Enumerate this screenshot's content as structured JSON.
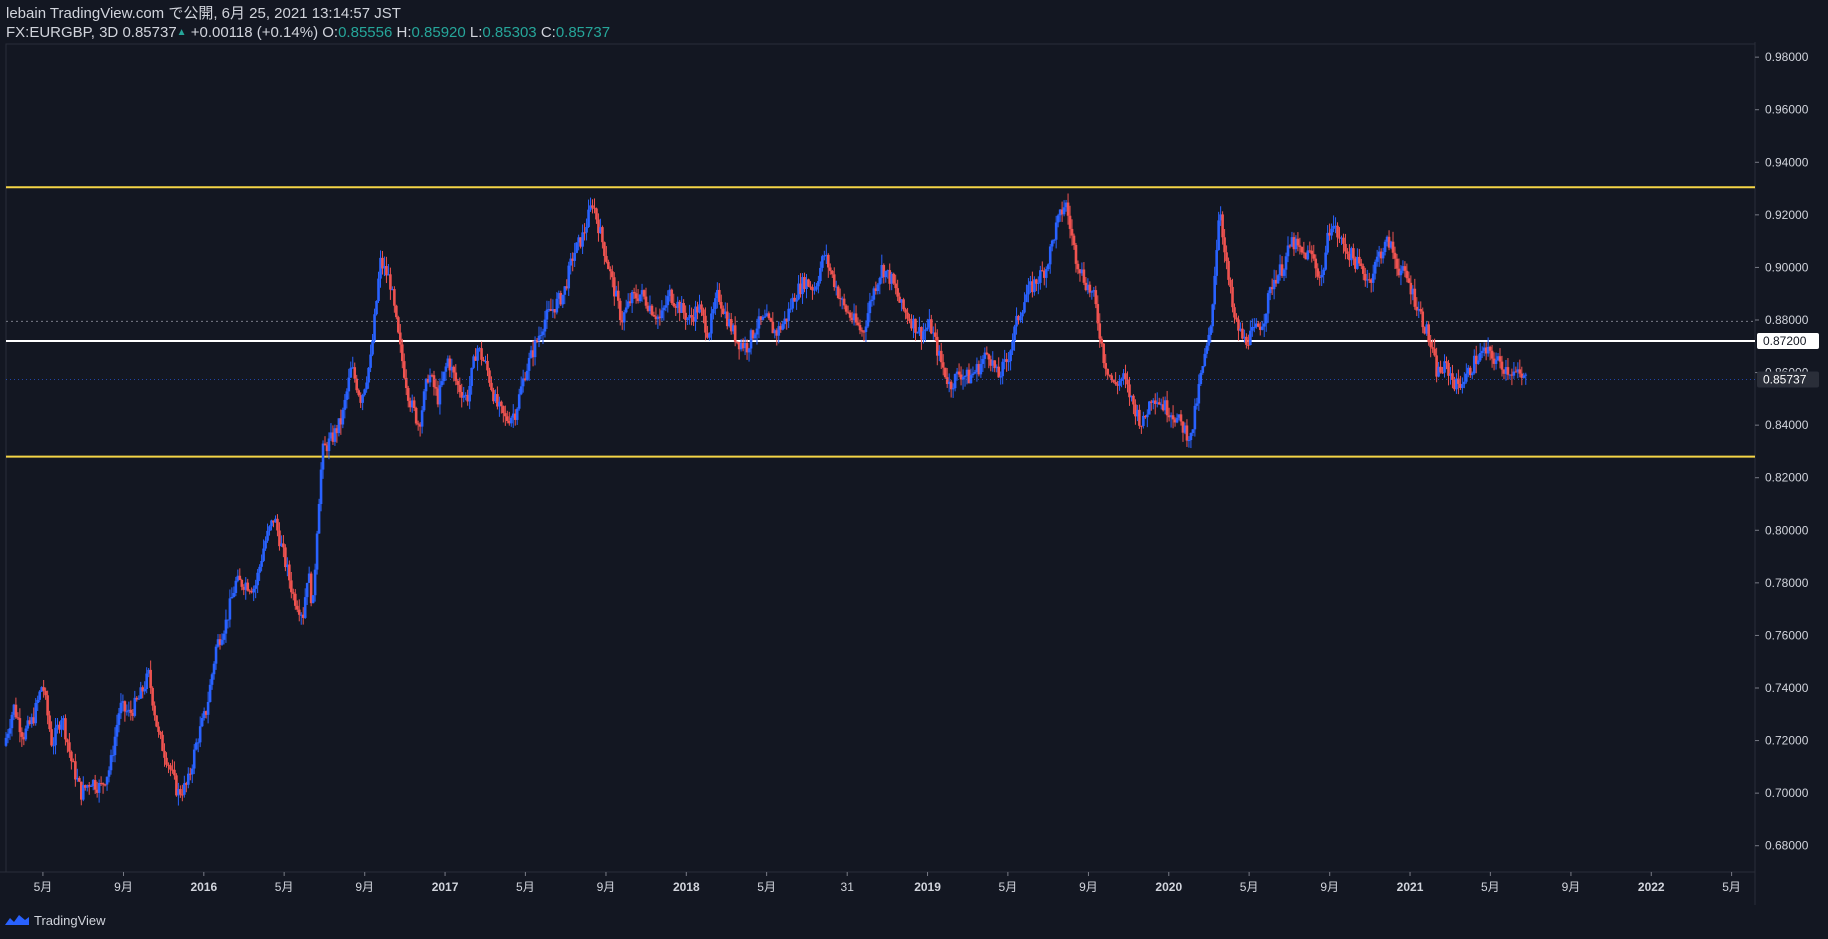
{
  "header": {
    "publisher_line": "lebain TradingView.com で公開, 6月 25, 2021 13:14:57 JST",
    "symbol": "FX:EURGBP, 3D",
    "last": "0.85737",
    "change": "+0.00118 (+0.14%)",
    "o_label": "O:",
    "o_value": "0.85556",
    "h_label": "H:",
    "h_value": "0.85920",
    "l_label": "L:",
    "l_value": "0.85303",
    "c_label": "C:",
    "c_value": "0.85737"
  },
  "footer": {
    "brand": "TradingView"
  },
  "colors": {
    "background": "#131722",
    "up": "#2962ff",
    "down": "#ef5350",
    "resistance": "#f5d547",
    "level": "#ffffff",
    "axis_text": "#d1d4dc"
  },
  "chart_data": {
    "type": "candlestick",
    "symbol": "FX:EURGBP",
    "interval": "3D",
    "ylim": [
      0.67,
      0.985
    ],
    "y_ticks": [
      "0.98000",
      "0.96000",
      "0.94000",
      "0.92000",
      "0.90000",
      "0.88000",
      "0.86000",
      "0.84000",
      "0.82000",
      "0.80000",
      "0.78000",
      "0.76000",
      "0.74000",
      "0.72000",
      "0.70000",
      "0.68000"
    ],
    "x_ticks": [
      {
        "label": "5月",
        "t": 2015.333
      },
      {
        "label": "9月",
        "t": 2015.667
      },
      {
        "label": "2016",
        "t": 2016.0
      },
      {
        "label": "5月",
        "t": 2016.333
      },
      {
        "label": "9月",
        "t": 2016.667
      },
      {
        "label": "2017",
        "t": 2017.0
      },
      {
        "label": "5月",
        "t": 2017.333
      },
      {
        "label": "9月",
        "t": 2017.667
      },
      {
        "label": "2018",
        "t": 2018.0
      },
      {
        "label": "5月",
        "t": 2018.333
      },
      {
        "label": "31",
        "t": 2018.667
      },
      {
        "label": "2019",
        "t": 2019.0
      },
      {
        "label": "5月",
        "t": 2019.333
      },
      {
        "label": "9月",
        "t": 2019.667
      },
      {
        "label": "2020",
        "t": 2020.0
      },
      {
        "label": "5月",
        "t": 2020.333
      },
      {
        "label": "9月",
        "t": 2020.667
      },
      {
        "label": "2021",
        "t": 2021.0
      },
      {
        "label": "5月",
        "t": 2021.333
      },
      {
        "label": "9月",
        "t": 2021.667
      },
      {
        "label": "2022",
        "t": 2022.0
      },
      {
        "label": "5月",
        "t": 2022.333
      }
    ],
    "x_range": [
      2015.18,
      2022.43
    ],
    "horizontal_lines": [
      {
        "name": "resistance",
        "price": 0.9305,
        "color": "#f5d547"
      },
      {
        "name": "support",
        "price": 0.828,
        "color": "#f5d547"
      },
      {
        "name": "level",
        "price": 0.872,
        "color": "#ffffff",
        "label": "0.87200"
      },
      {
        "name": "dotted",
        "price": 0.8795,
        "color": "#787b86"
      }
    ],
    "last_price_label": "0.85737",
    "last_price": 0.85737,
    "price_path": [
      [
        2015.18,
        0.718
      ],
      [
        2015.22,
        0.733
      ],
      [
        2015.26,
        0.722
      ],
      [
        2015.3,
        0.728
      ],
      [
        2015.34,
        0.742
      ],
      [
        2015.38,
        0.718
      ],
      [
        2015.42,
        0.73
      ],
      [
        2015.46,
        0.712
      ],
      [
        2015.5,
        0.7
      ],
      [
        2015.54,
        0.705
      ],
      [
        2015.58,
        0.702
      ],
      [
        2015.62,
        0.71
      ],
      [
        2015.66,
        0.733
      ],
      [
        2015.7,
        0.73
      ],
      [
        2015.74,
        0.736
      ],
      [
        2015.78,
        0.745
      ],
      [
        2015.82,
        0.722
      ],
      [
        2015.86,
        0.712
      ],
      [
        2015.9,
        0.7
      ],
      [
        2015.94,
        0.703
      ],
      [
        2015.98,
        0.72
      ],
      [
        2016.02,
        0.732
      ],
      [
        2016.06,
        0.756
      ],
      [
        2016.1,
        0.765
      ],
      [
        2016.14,
        0.78
      ],
      [
        2016.18,
        0.78
      ],
      [
        2016.22,
        0.778
      ],
      [
        2016.26,
        0.795
      ],
      [
        2016.3,
        0.805
      ],
      [
        2016.34,
        0.79
      ],
      [
        2016.38,
        0.775
      ],
      [
        2016.42,
        0.768
      ],
      [
        2016.44,
        0.785
      ],
      [
        2016.46,
        0.77
      ],
      [
        2016.48,
        0.805
      ],
      [
        2016.5,
        0.83
      ],
      [
        2016.54,
        0.835
      ],
      [
        2016.58,
        0.842
      ],
      [
        2016.62,
        0.862
      ],
      [
        2016.66,
        0.85
      ],
      [
        2016.7,
        0.865
      ],
      [
        2016.74,
        0.902
      ],
      [
        2016.78,
        0.895
      ],
      [
        2016.82,
        0.87
      ],
      [
        2016.86,
        0.85
      ],
      [
        2016.9,
        0.84
      ],
      [
        2016.94,
        0.86
      ],
      [
        2016.98,
        0.85
      ],
      [
        2017.02,
        0.865
      ],
      [
        2017.06,
        0.855
      ],
      [
        2017.1,
        0.85
      ],
      [
        2017.14,
        0.87
      ],
      [
        2017.18,
        0.862
      ],
      [
        2017.22,
        0.848
      ],
      [
        2017.26,
        0.842
      ],
      [
        2017.3,
        0.845
      ],
      [
        2017.34,
        0.86
      ],
      [
        2017.38,
        0.87
      ],
      [
        2017.42,
        0.88
      ],
      [
        2017.46,
        0.885
      ],
      [
        2017.5,
        0.89
      ],
      [
        2017.54,
        0.905
      ],
      [
        2017.58,
        0.912
      ],
      [
        2017.62,
        0.925
      ],
      [
        2017.66,
        0.91
      ],
      [
        2017.7,
        0.895
      ],
      [
        2017.74,
        0.88
      ],
      [
        2017.78,
        0.888
      ],
      [
        2017.82,
        0.89
      ],
      [
        2017.86,
        0.885
      ],
      [
        2017.9,
        0.88
      ],
      [
        2017.94,
        0.89
      ],
      [
        2017.98,
        0.885
      ],
      [
        2018.02,
        0.88
      ],
      [
        2018.06,
        0.885
      ],
      [
        2018.1,
        0.875
      ],
      [
        2018.14,
        0.89
      ],
      [
        2018.18,
        0.88
      ],
      [
        2018.22,
        0.872
      ],
      [
        2018.26,
        0.87
      ],
      [
        2018.3,
        0.878
      ],
      [
        2018.34,
        0.88
      ],
      [
        2018.38,
        0.875
      ],
      [
        2018.42,
        0.88
      ],
      [
        2018.46,
        0.89
      ],
      [
        2018.5,
        0.895
      ],
      [
        2018.54,
        0.892
      ],
      [
        2018.58,
        0.905
      ],
      [
        2018.62,
        0.895
      ],
      [
        2018.66,
        0.885
      ],
      [
        2018.7,
        0.88
      ],
      [
        2018.74,
        0.875
      ],
      [
        2018.78,
        0.89
      ],
      [
        2018.82,
        0.9
      ],
      [
        2018.86,
        0.895
      ],
      [
        2018.9,
        0.885
      ],
      [
        2018.94,
        0.88
      ],
      [
        2018.98,
        0.875
      ],
      [
        2019.02,
        0.878
      ],
      [
        2019.06,
        0.865
      ],
      [
        2019.1,
        0.855
      ],
      [
        2019.14,
        0.86
      ],
      [
        2019.18,
        0.858
      ],
      [
        2019.22,
        0.862
      ],
      [
        2019.26,
        0.868
      ],
      [
        2019.3,
        0.858
      ],
      [
        2019.34,
        0.865
      ],
      [
        2019.38,
        0.88
      ],
      [
        2019.42,
        0.89
      ],
      [
        2019.46,
        0.895
      ],
      [
        2019.5,
        0.9
      ],
      [
        2019.54,
        0.915
      ],
      [
        2019.58,
        0.925
      ],
      [
        2019.62,
        0.905
      ],
      [
        2019.66,
        0.895
      ],
      [
        2019.7,
        0.888
      ],
      [
        2019.74,
        0.865
      ],
      [
        2019.78,
        0.855
      ],
      [
        2019.82,
        0.858
      ],
      [
        2019.86,
        0.848
      ],
      [
        2019.9,
        0.84
      ],
      [
        2019.94,
        0.852
      ],
      [
        2019.98,
        0.848
      ],
      [
        2020.02,
        0.845
      ],
      [
        2020.06,
        0.84
      ],
      [
        2020.1,
        0.835
      ],
      [
        2020.14,
        0.858
      ],
      [
        2020.18,
        0.875
      ],
      [
        2020.22,
        0.925
      ],
      [
        2020.24,
        0.905
      ],
      [
        2020.28,
        0.88
      ],
      [
        2020.32,
        0.872
      ],
      [
        2020.36,
        0.875
      ],
      [
        2020.4,
        0.88
      ],
      [
        2020.44,
        0.895
      ],
      [
        2020.48,
        0.9
      ],
      [
        2020.52,
        0.91
      ],
      [
        2020.56,
        0.905
      ],
      [
        2020.6,
        0.905
      ],
      [
        2020.64,
        0.895
      ],
      [
        2020.68,
        0.918
      ],
      [
        2020.72,
        0.91
      ],
      [
        2020.76,
        0.905
      ],
      [
        2020.8,
        0.9
      ],
      [
        2020.84,
        0.895
      ],
      [
        2020.88,
        0.905
      ],
      [
        2020.92,
        0.91
      ],
      [
        2020.96,
        0.9
      ],
      [
        2021.0,
        0.895
      ],
      [
        2021.04,
        0.885
      ],
      [
        2021.08,
        0.875
      ],
      [
        2021.12,
        0.86
      ],
      [
        2021.16,
        0.862
      ],
      [
        2021.2,
        0.855
      ],
      [
        2021.24,
        0.858
      ],
      [
        2021.28,
        0.865
      ],
      [
        2021.32,
        0.868
      ],
      [
        2021.36,
        0.865
      ],
      [
        2021.4,
        0.862
      ],
      [
        2021.44,
        0.86
      ],
      [
        2021.48,
        0.8574
      ]
    ]
  }
}
